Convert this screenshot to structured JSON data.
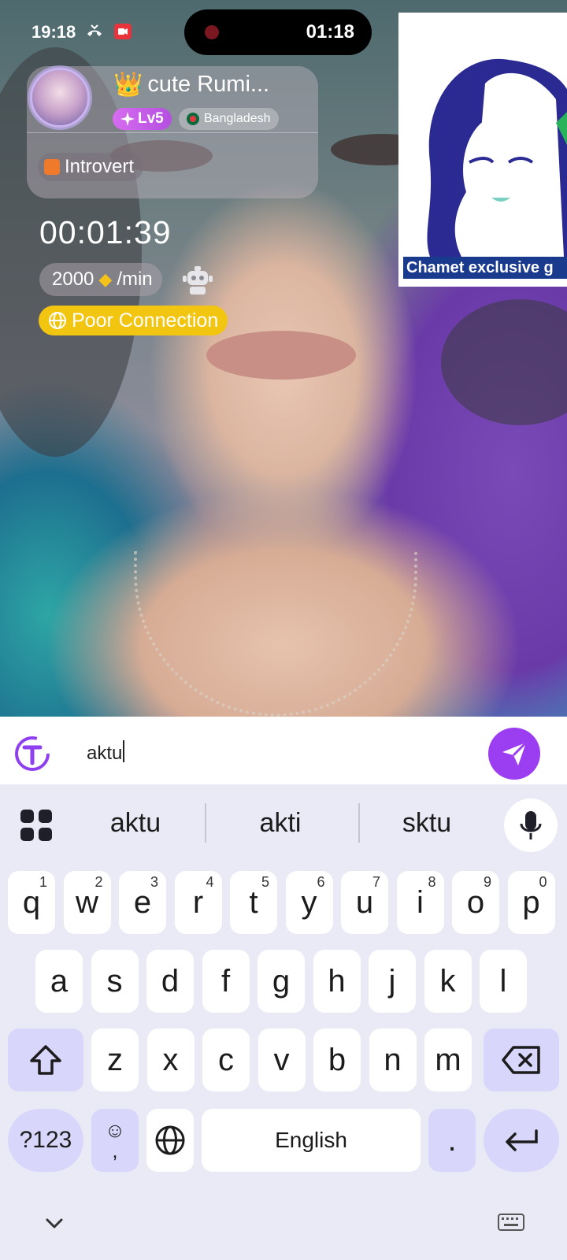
{
  "status_bar": {
    "time": "19:18"
  },
  "recording": {
    "elapsed": "01:18"
  },
  "profile": {
    "name": "cute Rumi...",
    "level": "Lv5",
    "country": "Bangladesh",
    "tag": "Introvert"
  },
  "call": {
    "duration": "00:01:39",
    "rate": "2000",
    "rate_unit": "/min",
    "connection": "Poor Connection"
  },
  "ad": {
    "caption": "Chamet exclusive g"
  },
  "input": {
    "value": "aktu"
  },
  "keyboard": {
    "suggestions": [
      "aktu",
      "akti",
      "sktu"
    ],
    "row1": [
      {
        "key": "q",
        "hint": "1"
      },
      {
        "key": "w",
        "hint": "2"
      },
      {
        "key": "e",
        "hint": "3"
      },
      {
        "key": "r",
        "hint": "4"
      },
      {
        "key": "t",
        "hint": "5"
      },
      {
        "key": "y",
        "hint": "6"
      },
      {
        "key": "u",
        "hint": "7"
      },
      {
        "key": "i",
        "hint": "8"
      },
      {
        "key": "o",
        "hint": "9"
      },
      {
        "key": "p",
        "hint": "0"
      }
    ],
    "row2": [
      "a",
      "s",
      "d",
      "f",
      "g",
      "h",
      "j",
      "k",
      "l"
    ],
    "row3": [
      "z",
      "x",
      "c",
      "v",
      "b",
      "n",
      "m"
    ],
    "symbols_label": "?123",
    "emoji_comma": ",",
    "space_label": "English",
    "period": "."
  },
  "colors": {
    "send": "#9b3df0",
    "poor_connection": "#f2c511",
    "special_key": "#d9d6fb"
  }
}
